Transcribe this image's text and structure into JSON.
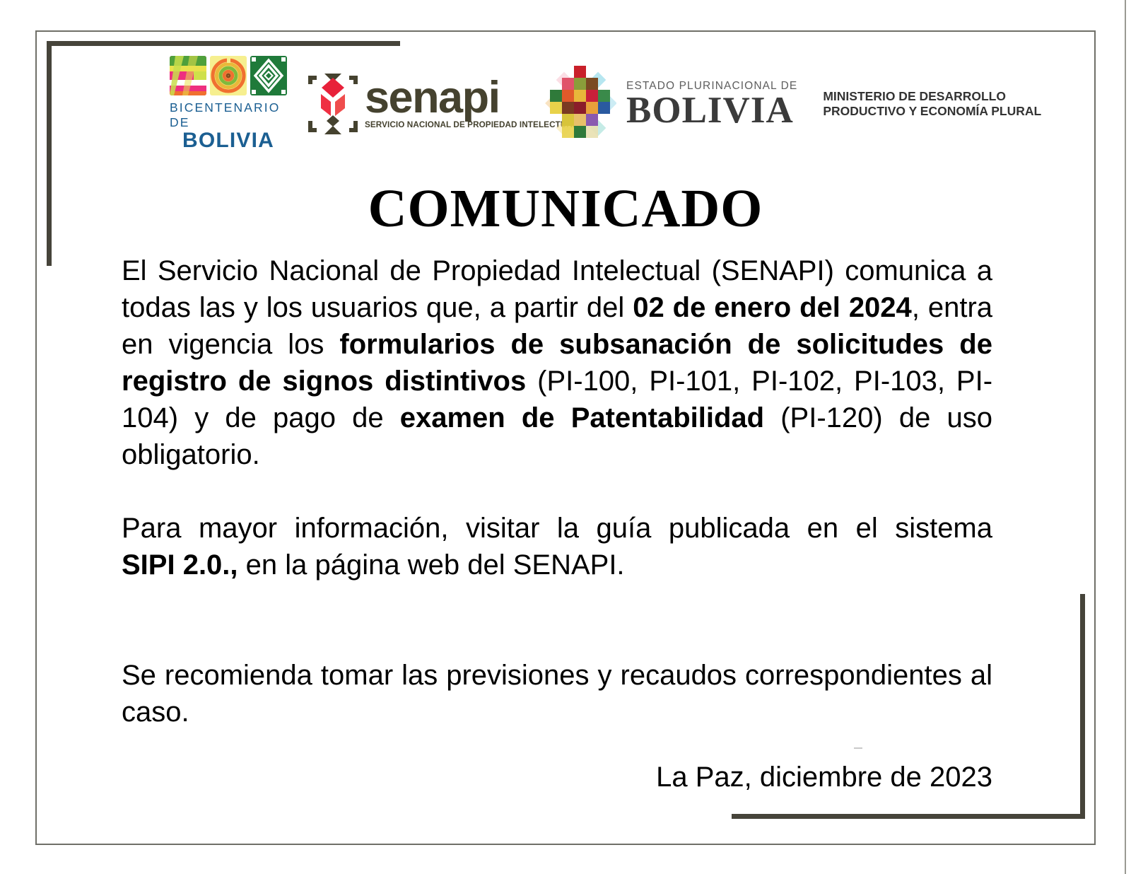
{
  "document": {
    "title": "COMUNICADO",
    "background_color": "#ffffff",
    "frame_color": "#46443a",
    "outer_frame_color": "#6f6f68"
  },
  "header": {
    "logos": [
      {
        "name": "bicentenario-de-bolivia",
        "label_top": "BICENTENARIO DE",
        "label_bottom": "BOLIVIA",
        "text_color": "#1b5f92",
        "tile_colors": [
          "#e8308a",
          "#f4e04a",
          "#1f7a3a"
        ]
      },
      {
        "name": "senapi",
        "wordmark": "senapi",
        "tagline": "SERVICIO NACIONAL DE PROPIEDAD INTELECTUAL",
        "mark_color": "#45422f",
        "accent_color": "#e8213a"
      },
      {
        "name": "estado-plurinacional-de-bolivia",
        "label_top": "ESTADO PLURINACIONAL DE",
        "label_bottom": "BOLIVIA",
        "text_color": "#3b3b3b"
      },
      {
        "name": "ministerio-de-desarrollo-productivo",
        "line1": "MINISTERIO DE DESARROLLO",
        "line2": "PRODUCTIVO Y ECONOMÍA PLURAL",
        "text_color": "#333333"
      }
    ]
  },
  "body": {
    "paragraph_1": {
      "seg_1": "El Servicio Nacional de Propiedad Intelectual (SENAPI) comunica a todas las y los usuarios que, a partir del ",
      "seg_2_bold": "02 de enero del 2024",
      "seg_3": ", entra en vigencia los ",
      "seg_4_bold": "formularios de subsanación de solicitudes de registro de signos distintivos",
      "seg_5": " (PI-100, PI-101, PI-102, PI-103, PI-104) y de pago de ",
      "seg_6_bold": "examen de Patentabilidad",
      "seg_7": " (PI-120) de uso obligatorio."
    },
    "paragraph_2": {
      "seg_1": "Para mayor información, visitar la guía publicada en el sistema ",
      "seg_2_bold": "SIPI 2.0.,",
      "seg_3": " en la página web del SENAPI."
    },
    "paragraph_3": {
      "seg_1": "Se recomienda tomar las previsiones y recaudos correspondientes al caso."
    }
  },
  "footer": {
    "signature": "La Paz, diciembre de 2023"
  }
}
